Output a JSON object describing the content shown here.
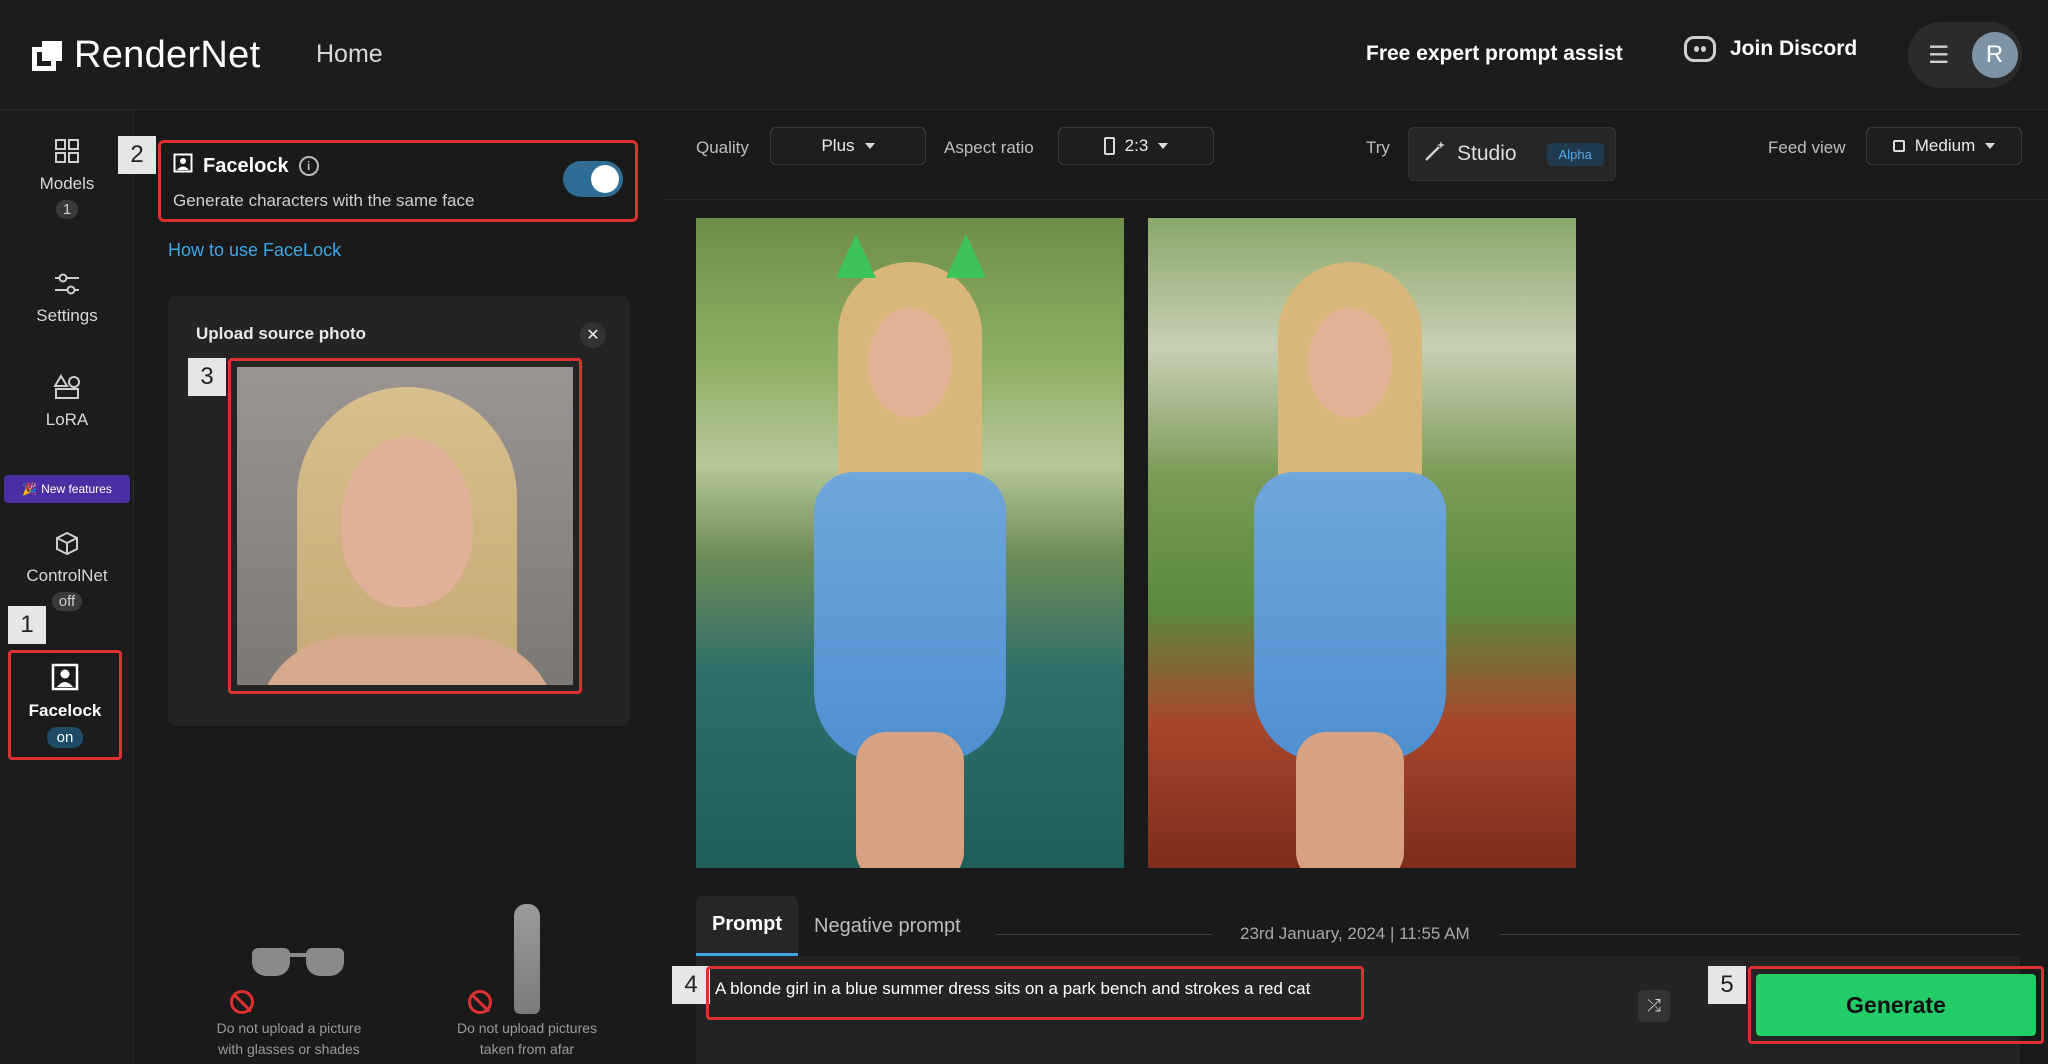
{
  "app": {
    "logo_text": "RenderNet",
    "nav_home": "Home",
    "expert_assist": "Free expert prompt assist",
    "join_discord": "Join Discord",
    "avatar_initial": "R",
    "hamburger_glyph": "☰"
  },
  "rail": {
    "models_label": "Models",
    "models_badge": "1",
    "settings_label": "Settings",
    "lora_label": "LoRA",
    "new_features": "New features",
    "controlnet_label": "ControlNet",
    "controlnet_state": "off",
    "facelock_label": "Facelock",
    "facelock_state": "on"
  },
  "steps": [
    "1",
    "2",
    "3",
    "4",
    "5"
  ],
  "facelock": {
    "title": "Facelock",
    "subtitle": "Generate characters with the same face",
    "enabled": true,
    "how_to": "How to use FaceLock",
    "upload_title": "Upload source photo",
    "close_glyph": "✕"
  },
  "tips": [
    {
      "line1": "Do not upload a picture",
      "line2": "with glasses or shades"
    },
    {
      "line1": "Do not upload pictures",
      "line2": "taken from afar"
    }
  ],
  "toolbar": {
    "quality_label": "Quality",
    "quality_value": "Plus",
    "aspect_label": "Aspect ratio",
    "aspect_value": "2:3",
    "try_label": "Try",
    "studio_label": "Studio",
    "studio_badge": "Alpha",
    "feed_label": "Feed view",
    "feed_value": "Medium"
  },
  "prompt": {
    "tab_prompt": "Prompt",
    "tab_negative": "Negative prompt",
    "timestamp": "23rd January, 2024 | 11:55 AM",
    "text": "A blonde girl in a blue summer dress sits on a park bench and strokes a red cat",
    "shuffle_glyph": "⤮",
    "generate_label": "Generate"
  },
  "colors": {
    "accent_red": "#e03131",
    "generate_green": "#22cc66",
    "link_blue": "#3ea6e6",
    "toggle_on": "#2f6d96"
  }
}
